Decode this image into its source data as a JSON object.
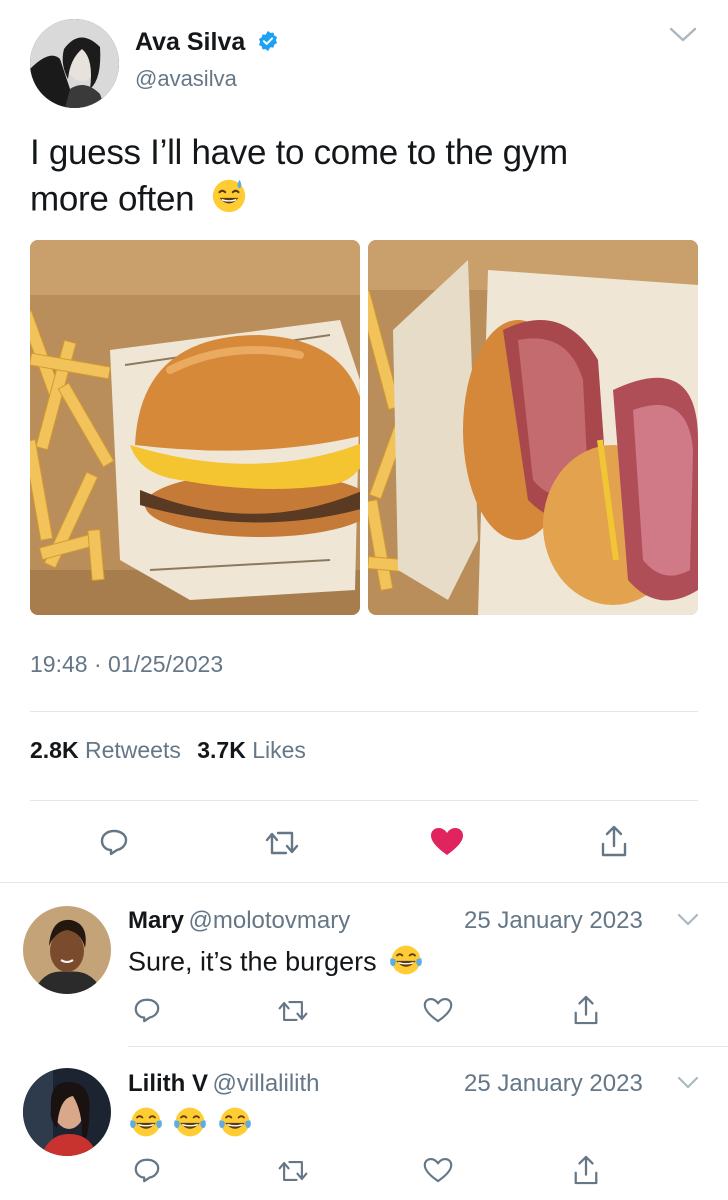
{
  "tweet": {
    "author_name": "Ava Silva",
    "author_handle": "@avasilva",
    "text_line1": "I guess I’ll have to come to the gym",
    "text_line2": "more often",
    "timestamp": "19:48 · 01/25/2023",
    "retweets_count": "2.8K",
    "retweets_label": "Retweets",
    "likes_count": "3.7K",
    "likes_label": "Likes"
  },
  "replies": [
    {
      "name": "Mary",
      "handle": "@molotovmary",
      "date": "25 January 2023",
      "text": "Sure, it’s the burgers"
    },
    {
      "name": "Lilith V",
      "handle": "@villalilith",
      "date": "25 January 2023",
      "text": ""
    }
  ],
  "colors": {
    "verified_blue": "#1da1f2",
    "like_red": "#e0245e",
    "icon_gray": "#657786",
    "divider": "#e1e8ed"
  },
  "icons": [
    "verified-badge-icon",
    "chevron-down-icon",
    "reply-icon",
    "retweet-icon",
    "heart-icon",
    "share-icon",
    "sweat-smile-emoji",
    "tears-of-joy-emoji"
  ]
}
